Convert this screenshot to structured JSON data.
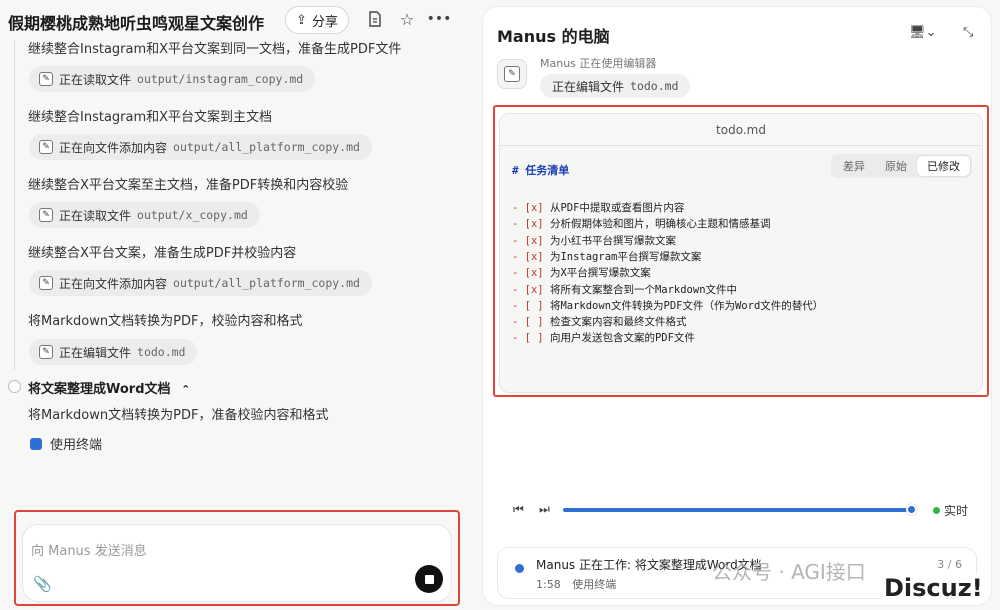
{
  "left": {
    "title": "假期樱桃成熟地听虫鸣观星文案创作",
    "share_label": "分享",
    "steps": [
      {
        "text": "继续整合Instagram和X平台文案到同一文档，准备生成PDF文件",
        "chip_action": "正在读取文件",
        "chip_file": "output/instagram_copy.md"
      },
      {
        "text": "继续整合Instagram和X平台文案到主文档",
        "chip_action": "正在向文件添加内容",
        "chip_file": "output/all_platform_copy.md"
      },
      {
        "text": "继续整合X平台文案至主文档，准备PDF转换和内容校验",
        "chip_action": "正在读取文件",
        "chip_file": "output/x_copy.md"
      },
      {
        "text": "继续整合X平台文案，准备生成PDF并校验内容",
        "chip_action": "正在向文件添加内容",
        "chip_file": "output/all_platform_copy.md"
      },
      {
        "text": "将Markdown文档转换为PDF，校验内容和格式",
        "chip_action": "正在编辑文件",
        "chip_file": "todo.md"
      }
    ],
    "section_title": "将文案整理成Word文档",
    "section_desc": "将Markdown文档转换为PDF，准备校验内容和格式",
    "terminal_label": "使用终端",
    "input_placeholder": "向 Manus 发送消息"
  },
  "right": {
    "title": "Manus 的电脑",
    "agent_status": "Manus 正在使用编辑器",
    "agent_action": "正在编辑文件",
    "agent_file": "todo.md",
    "editor_title": "todo.md",
    "heading": "# 任务清单",
    "tabs": [
      "差异",
      "原始",
      "已修改"
    ],
    "active_tab": "已修改",
    "todos": [
      {
        "box": "[x]",
        "text": "从PDF中提取或查看图片内容"
      },
      {
        "box": "[x]",
        "text": "分析假期体验和图片，明确核心主题和情感基调"
      },
      {
        "box": "[x]",
        "text": "为小红书平台撰写爆款文案"
      },
      {
        "box": "[x]",
        "text": "为Instagram平台撰写爆款文案"
      },
      {
        "box": "[x]",
        "text": "为X平台撰写爆款文案"
      },
      {
        "box": "[x]",
        "text": "将所有文案整合到一个Markdown文件中"
      },
      {
        "box": "[ ]",
        "text": "将Markdown文件转换为PDF文件（作为Word文件的替代）"
      },
      {
        "box": "[ ]",
        "text": "检查文案内容和最终文件格式"
      },
      {
        "box": "[ ]",
        "text": "向用户发送包含文案的PDF文件"
      }
    ],
    "live_label": "实时",
    "playback_progress": 0.97,
    "status_text": "Manus 正在工作: 将文案整理成Word文档",
    "status_time": "1:58",
    "status_sub": "使用终端",
    "status_count": "3 / 6"
  },
  "watermark": {
    "text": "公众号 · AGI接口",
    "badge": "Discuz!"
  },
  "colors": {
    "highlight": "#e0453a",
    "accent": "#2d6fd3",
    "live": "#2fb344"
  }
}
